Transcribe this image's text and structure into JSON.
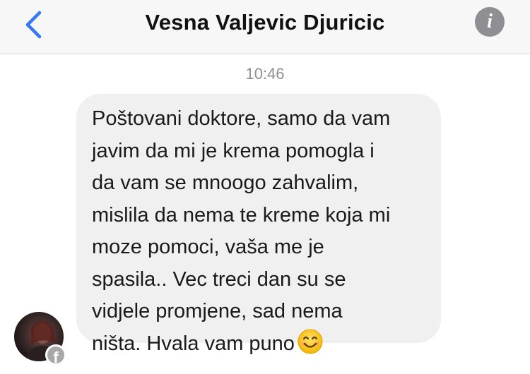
{
  "header": {
    "contact_name": "Vesna Valjevic Djuricic"
  },
  "conversation": {
    "timestamp": "10:46",
    "message": {
      "lines": [
        "Poštovani doktore, samo da vam",
        "javim da mi je krema pomogla i",
        "da vam se mnoogo zahvalim,",
        "mislila da nema te kreme koja mi",
        "moze pomoci, vaša me je",
        "spasila.. Vec treci dan su se",
        "vidjele promjene, sad nema",
        "ništa. Hvala vam puno"
      ],
      "emoji": "smiling-face-emoji"
    }
  },
  "icons": {
    "back": "chevron-left-icon",
    "info": "info-icon",
    "badge": "facebook-icon"
  },
  "colors": {
    "accent": "#3478f6",
    "header_bg": "#f7f7f7",
    "bubble_bg": "#f0f0f0",
    "timestamp": "#8e8e93",
    "info_icon": "#8e8e93"
  }
}
